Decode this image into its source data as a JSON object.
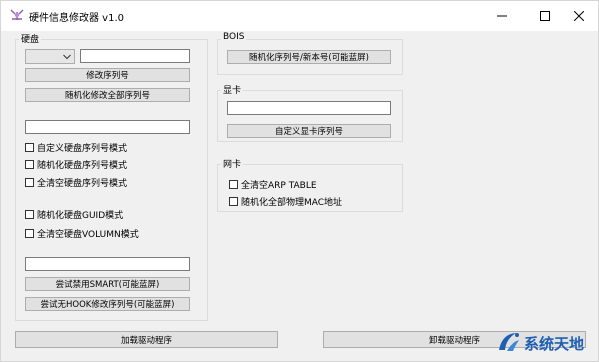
{
  "window": {
    "title": "硬件信息修改器 v1.0",
    "controls": {
      "minimize": "minimize-icon",
      "maximize": "maximize-icon",
      "close": "close-icon"
    }
  },
  "disk": {
    "group_label": "硬盘",
    "combo_value": "",
    "serial_value": "",
    "modify_serial_label": "修改序列号",
    "randomize_all_label": "随机化修改全部序列号",
    "custom_serial_value": "",
    "modes": [
      {
        "label": "自定义硬盘序列号模式",
        "checked": false
      },
      {
        "label": "随机化硬盘序列号模式",
        "checked": false
      },
      {
        "label": "全清空硬盘序列号模式",
        "checked": false
      }
    ],
    "guid_modes": [
      {
        "label": "随机化硬盘GUID模式",
        "checked": false
      },
      {
        "label": "全清空硬盘VOLUMN模式",
        "checked": false
      }
    ],
    "extra_value": "",
    "disable_smart_label": "尝试禁用SMART(可能蓝屏)",
    "nohook_label": "尝试无HOOK修改序列号(可能蓝屏)"
  },
  "bios": {
    "group_label": "BOIS",
    "randomize_label": "随机化序列号/新本号(可能蓝屏)"
  },
  "gpu": {
    "group_label": "显卡",
    "serial_value": "",
    "custom_label": "自定义显卡序列号"
  },
  "nic": {
    "group_label": "网卡",
    "options": [
      {
        "label": "全清空ARP TABLE",
        "checked": false
      },
      {
        "label": "随机化全部物理MAC地址",
        "checked": false
      }
    ]
  },
  "footer": {
    "load_driver_label": "加载驱动程序",
    "unload_driver_label": "卸载驱动程序"
  },
  "watermark": {
    "text": "系统天地",
    "icon": "watermark-logo-icon",
    "color": "#1e5fb4"
  }
}
